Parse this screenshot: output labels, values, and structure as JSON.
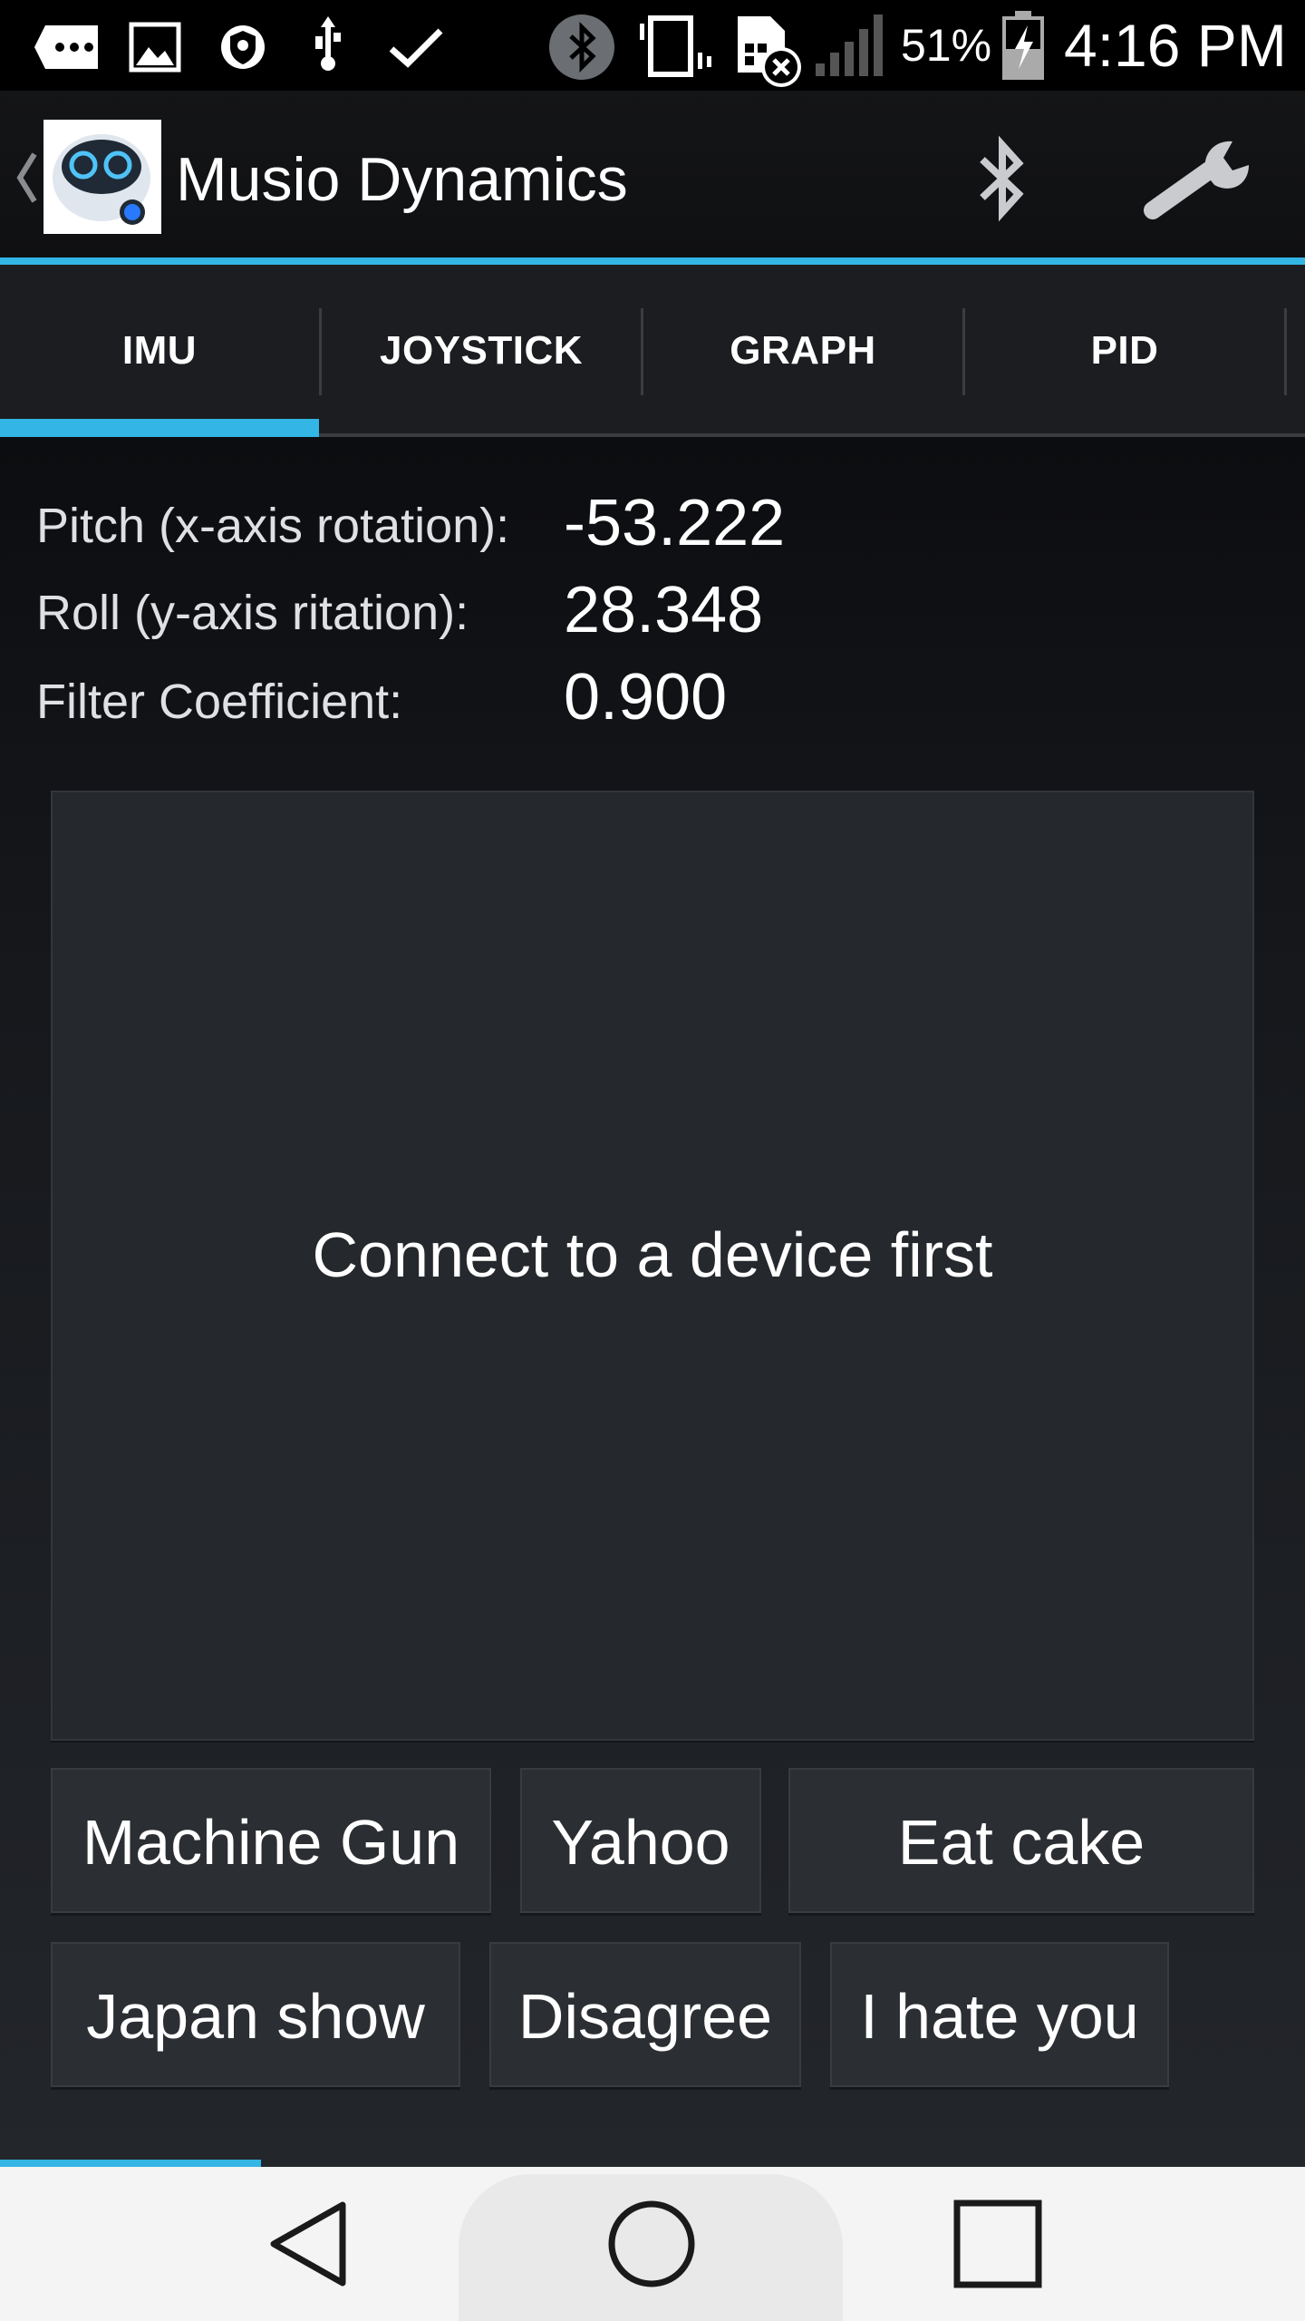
{
  "status_bar": {
    "battery_percent": "51%",
    "time": "4:16 PM",
    "icons": [
      "message-more-icon",
      "image-icon",
      "shield-icon",
      "usb-icon",
      "check-icon",
      "bluetooth-icon",
      "vibrate-icon",
      "no-sim-icon",
      "signal-icon",
      "battery-charging-icon"
    ]
  },
  "action_bar": {
    "title": "Musio Dynamics",
    "actions": [
      "bluetooth-icon",
      "wrench-icon"
    ]
  },
  "tabs": [
    {
      "label": "IMU",
      "selected": true
    },
    {
      "label": "JOYSTICK",
      "selected": false
    },
    {
      "label": "GRAPH",
      "selected": false
    },
    {
      "label": "PID",
      "selected": false
    }
  ],
  "imu": {
    "pitch": {
      "label": "Pitch (x-axis rotation):",
      "value": "-53.222"
    },
    "roll": {
      "label": "Roll (y-axis ritation):",
      "value": "28.348"
    },
    "filter": {
      "label": "Filter Coefficient:",
      "value": "0.900"
    }
  },
  "pad": {
    "message": "Connect to a device first"
  },
  "buttons": {
    "machine_gun": "Machine Gun",
    "yahoo": "Yahoo",
    "eat_cake": "Eat cake",
    "japan_show": "Japan show",
    "disagree": "Disagree",
    "i_hate_you": "I hate you"
  },
  "colors": {
    "accent": "#33b5e5",
    "background": "#0b0c0e",
    "pad": "#25282d",
    "nav_bar": "#f4f4f4"
  }
}
